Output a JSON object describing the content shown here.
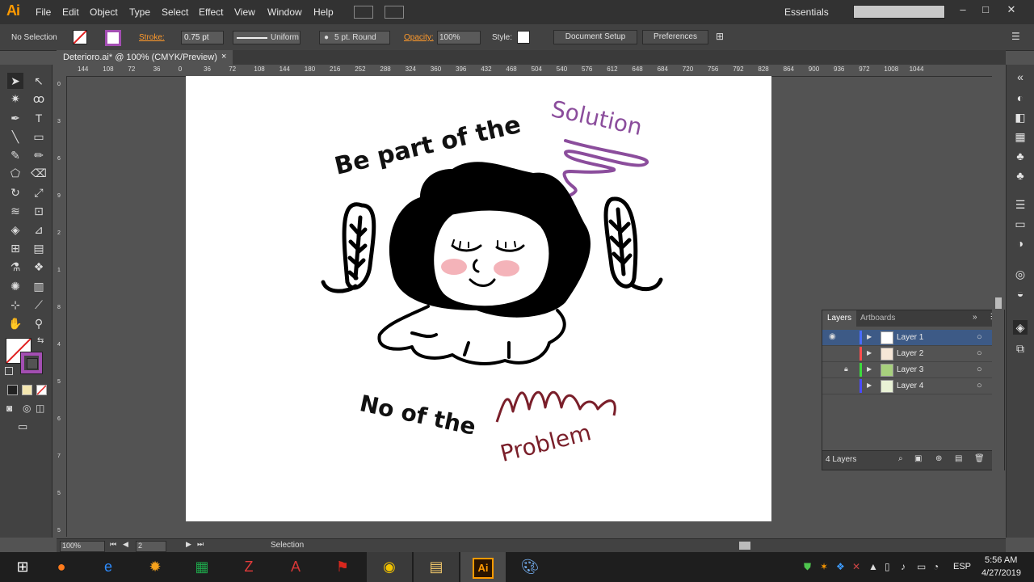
{
  "app": {
    "logo": "Ai"
  },
  "menu": [
    "File",
    "Edit",
    "Object",
    "Type",
    "Select",
    "Effect",
    "View",
    "Window",
    "Help"
  ],
  "workspace": "Essentials",
  "window_buttons": [
    "–",
    "□",
    "✕"
  ],
  "control": {
    "selection_status": "No Selection",
    "stroke_label": "Stroke:",
    "stroke_weight": "0.75 pt",
    "profile": "Uniform",
    "brush": "5 pt. Round",
    "opacity_label": "Opacity:",
    "opacity": "100%",
    "style_label": "Style:",
    "document_setup": "Document Setup",
    "preferences": "Preferences"
  },
  "document_tab": {
    "title": "Deterioro.ai* @ 100% (CMYK/Preview)",
    "close": "×"
  },
  "ruler_ticks": [
    "144",
    "108",
    "72",
    "36",
    "0",
    "36",
    "72",
    "108",
    "144",
    "180",
    "216",
    "252",
    "288",
    "324",
    "360",
    "396",
    "432",
    "468",
    "504",
    "540",
    "576",
    "612",
    "648",
    "684",
    "720",
    "756",
    "792",
    "828",
    "864",
    "900",
    "936",
    "972",
    "1008",
    "1044"
  ],
  "artwork": {
    "headline_black": "Be part of the",
    "headline_accent": "Solution",
    "footer_black": "No of the",
    "footer_accent": "Problem",
    "accent_purple": "#8b4d9c",
    "accent_maroon": "#7a1f2a",
    "blush": "#f4b3b9"
  },
  "layers_panel": {
    "tabs": [
      "Layers",
      "Artboards"
    ],
    "layers": [
      {
        "name": "Layer 1",
        "color": "#4a6cff",
        "visible": true,
        "locked": false,
        "selected": true
      },
      {
        "name": "Layer 2",
        "color": "#ff4d4d",
        "visible": false,
        "locked": false,
        "selected": false
      },
      {
        "name": "Layer 3",
        "color": "#3ddc3d",
        "visible": false,
        "locked": true,
        "selected": false
      },
      {
        "name": "Layer 4",
        "color": "#4a4aff",
        "visible": false,
        "locked": false,
        "selected": false
      }
    ],
    "count": "4 Layers"
  },
  "status": {
    "zoom": "100%",
    "artboard_number": "2",
    "tool": "Selection"
  },
  "taskbar": {
    "language": "ESP",
    "time": "5:56 AM",
    "date": "4/27/2019"
  }
}
